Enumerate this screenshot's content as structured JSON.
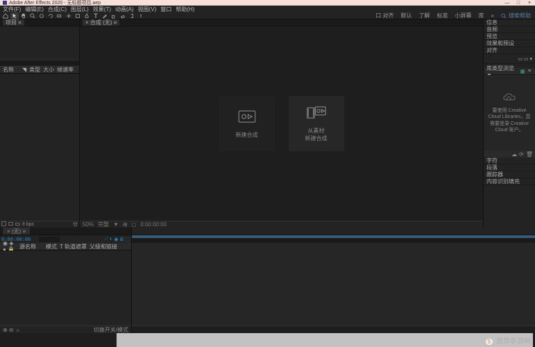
{
  "window": {
    "title": "Adobe After Effects 2020 - 无标题项目.aep",
    "min": "—",
    "max": "□",
    "close": "×"
  },
  "menu": {
    "file": "文件(F)",
    "edit": "编辑(E)",
    "comp": "合成(C)",
    "layer": "图层(L)",
    "effect": "效果(T)",
    "anim": "动画(A)",
    "view": "视图(V)",
    "window": "窗口",
    "help": "帮助(H)"
  },
  "toolbar": {
    "right": {
      "snap": "口 对齐",
      "default": "默认",
      "learn": "了解",
      "standard": "标准",
      "small": "小屏幕",
      "lib": "库",
      "search": "搜索帮助"
    }
  },
  "project": {
    "tab": "项目 ≡",
    "cols": {
      "name": "名称",
      "type": "类型",
      "size": "大小",
      "fps": "帧速率"
    },
    "footer_bpc": "8 bpc"
  },
  "composition": {
    "tab": "× 合成 (无) ≡",
    "card1": {
      "label": "新建合成"
    },
    "card2": {
      "line1": "从素材",
      "line2": "新建合成"
    },
    "footer": {
      "zoom": "50%",
      "res": "完整",
      "time": "0:00:00:00"
    }
  },
  "right": {
    "info": "信息",
    "audio": "音频",
    "preview": "预览",
    "fx": "效果和预设",
    "align": "对齐",
    "lib_hdr": "库类型浏览 ▼",
    "lib_msg": "要使用 Creative Cloud Libraries，您需要登录 Creative Cloud 账户。",
    "char": "字符",
    "para": "段落",
    "tracker": "跟踪器",
    "brush": "内容识别填充"
  },
  "timeline": {
    "tab": "× (无) ≡",
    "tc": "0:00:00:00",
    "cols": {
      "src": "源名称",
      "blend": "模式",
      "matte": "T  轨道遮罩",
      "parent": "父级和链接"
    },
    "footer_left": "⊕ ⊖ ☼",
    "footer_mode": "切换开关/模式"
  },
  "watermark": {
    "badge": "5",
    "text": "京华手游网"
  }
}
